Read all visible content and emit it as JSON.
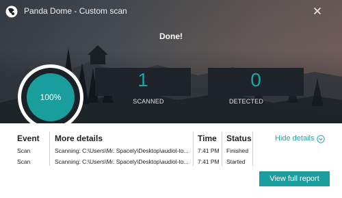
{
  "window": {
    "title": "Panda Dome - Custom scan"
  },
  "status": {
    "headline": "Done!"
  },
  "progress": {
    "percent": 100,
    "label": "100%"
  },
  "metrics": [
    {
      "value": "1",
      "label": "SCANNED"
    },
    {
      "value": "0",
      "label": "DETECTED"
    }
  ],
  "details": {
    "headers": {
      "event": "Event",
      "more": "More details",
      "time": "Time",
      "status": "Status"
    },
    "rows": [
      {
        "event": "Scan",
        "more": "Scanning: C:\\Users\\Mr. Spacely\\Desktop\\audiol-to...",
        "time": "7:41 PM",
        "status": "Finished"
      },
      {
        "event": "Scan",
        "more": "Scanning: C:\\Users\\Mr. Spacely\\Desktop\\audiol-to...",
        "time": "7:41 PM",
        "status": "Started"
      }
    ],
    "hide_label": "Hide details"
  },
  "actions": {
    "report_label": "View full report"
  },
  "colors": {
    "accent": "#1a9e9d",
    "banner_dark": "#1d2328"
  },
  "icons": {
    "logo": "panda-logo-icon",
    "close": "close-icon",
    "hide": "chevron-up-circle-icon"
  }
}
